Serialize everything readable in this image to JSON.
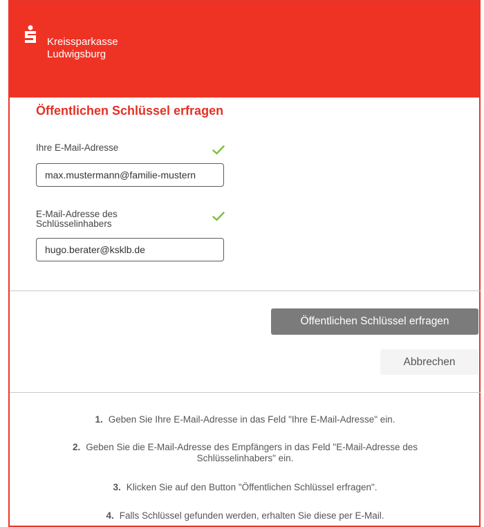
{
  "brand": {
    "line1": "Kreissparkasse",
    "line2": "Ludwigsburg",
    "color": "#ee3325"
  },
  "form": {
    "title": "Öffentlichen Schlüssel erfragen",
    "own_email": {
      "label": "Ihre E-Mail-Adresse",
      "value": "max.mustermann@familie-mustern",
      "valid": true
    },
    "holder_email": {
      "label_line1": "E-Mail-Adresse des",
      "label_line2": "Schlüsselinhabers",
      "value": "hugo.berater@ksklb.de",
      "valid": true
    }
  },
  "actions": {
    "request_label": "Öffentlichen Schlüssel erfragen",
    "cancel_label": "Abbrechen"
  },
  "steps": [
    {
      "num": "1.",
      "text": "Geben Sie Ihre E-Mail-Adresse in das Feld \"Ihre E-Mail-Adresse\" ein."
    },
    {
      "num": "2.",
      "text": "Geben Sie die E-Mail-Adresse des Empfängers in das Feld \"E-Mail-Adresse des",
      "text2": "Schlüsselinhabers\" ein."
    },
    {
      "num": "3.",
      "text": "Klicken Sie auf den Button \"Öffentlichen Schlüssel erfragen\"."
    },
    {
      "num": "4.",
      "text": "Falls Schlüssel gefunden werden, erhalten Sie diese per E-Mail."
    }
  ],
  "icons": {
    "logo": "sparkasse-s-logo",
    "check": "checkmark-icon"
  },
  "colors": {
    "accent": "#e53025",
    "check": "#7cbf3a",
    "button": "#7b7b7b"
  }
}
